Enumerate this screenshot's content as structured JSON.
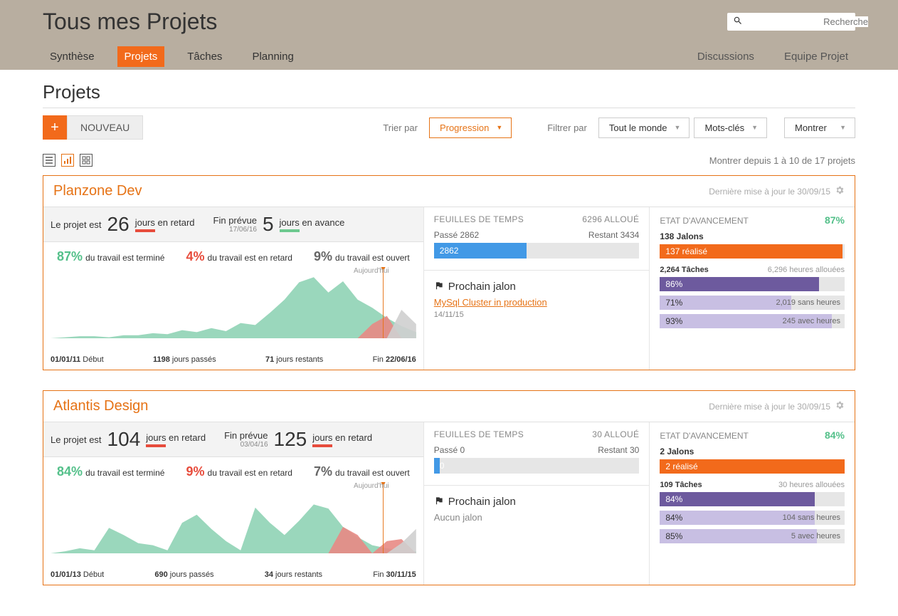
{
  "header": {
    "title": "Tous mes Projets",
    "search_placeholder": "Recherche"
  },
  "nav": {
    "left": [
      "Synthèse",
      "Projets",
      "Tâches",
      "Planning"
    ],
    "right": [
      "Discussions",
      "Equipe Projet"
    ],
    "active_index": 1
  },
  "section": {
    "title": "Projets",
    "new_label": "NOUVEAU",
    "sort_label": "Trier par",
    "sort_value": "Progression",
    "filter_label": "Filtrer par",
    "filter_who": "Tout le monde",
    "filter_tags": "Mots-clés",
    "show_label": "Montrer",
    "pager": "Montrer depuis 1 à 10 de 17 projets"
  },
  "labels": {
    "project_is": "Le projet est",
    "days_late": "jours en retard",
    "days_early": "jours en avance",
    "planned_end": "Fin prévue",
    "today": "Aujourd'hui",
    "start": "Début",
    "end": "Fin",
    "days_passed": "jours passés",
    "days_remaining": "jours restants",
    "timesheets": "FEUILLES DE TEMPS",
    "allocated": "alloué",
    "spent": "Passé",
    "remaining": "Restant",
    "next_milestone": "Prochain jalon",
    "no_milestone": "Aucun jalon",
    "progress": "ETAT D'AVANCEMENT",
    "milestones": "Jalons",
    "done": "réalisé",
    "tasks": "Tâches",
    "hours_allocated": "heures allouées",
    "without_hours": "sans heures",
    "with_hours": "avec heures",
    "work_done": "du travail est terminé",
    "work_late": "du travail est en retard",
    "work_open": "du travail est ouvert",
    "last_update": "Dernière mise à jour le"
  },
  "projects": [
    {
      "name": "Planzone Dev",
      "updated": "30/09/15",
      "delay_days": 26,
      "delay_direction": "late",
      "end_planned_date": "17/06/16",
      "end_delta_days": 5,
      "end_delta_direction": "early",
      "pct_done": 87,
      "pct_late": 4,
      "pct_open": 9,
      "timeline": {
        "start": "01/01/11",
        "end": "22/06/16",
        "days_passed": 1198,
        "days_remaining": 71
      },
      "timesheets": {
        "allocated": 6296,
        "spent": 2862,
        "remaining": 3434,
        "bar_pct": 45
      },
      "milestone": {
        "name": "MySql Cluster in production",
        "date": "14/11/15"
      },
      "progress": {
        "overall_pct": 87,
        "milestones_total": 138,
        "milestones_done": 137,
        "milestones_pct": 99,
        "tasks_total": "2,264",
        "tasks_pct": 86,
        "hours_allocated": "6,296",
        "no_hours_pct": 71,
        "no_hours_count": "2,019",
        "with_hours_pct": 93,
        "with_hours_count": "245"
      },
      "chart_data": {
        "type": "area",
        "series": [
          {
            "name": "done",
            "color": "#8fd3b5",
            "values": [
              0,
              1,
              2,
              2,
              1,
              3,
              3,
              5,
              4,
              8,
              6,
              10,
              7,
              15,
              13,
              25,
              38,
              55,
              60,
              45,
              56,
              38,
              30,
              20,
              12,
              6
            ]
          },
          {
            "name": "late",
            "color": "#e88a84",
            "values": [
              0,
              0,
              0,
              0,
              0,
              0,
              0,
              0,
              0,
              0,
              0,
              0,
              0,
              0,
              0,
              0,
              0,
              0,
              0,
              0,
              0,
              0,
              14,
              22,
              0,
              0
            ]
          },
          {
            "name": "open",
            "color": "#cfcfcf",
            "values": [
              0,
              0,
              0,
              0,
              0,
              0,
              0,
              0,
              0,
              0,
              0,
              0,
              0,
              0,
              0,
              0,
              0,
              0,
              0,
              0,
              0,
              0,
              0,
              0,
              28,
              14
            ]
          }
        ]
      }
    },
    {
      "name": "Atlantis Design",
      "updated": "30/09/15",
      "delay_days": 104,
      "delay_direction": "late",
      "end_planned_date": "03/04/16",
      "end_delta_days": 125,
      "end_delta_direction": "late",
      "pct_done": 84,
      "pct_late": 9,
      "pct_open": 7,
      "timeline": {
        "start": "01/01/13",
        "end": "30/11/15",
        "days_passed": 690,
        "days_remaining": 34
      },
      "timesheets": {
        "allocated": 30,
        "spent": 0,
        "remaining": 30,
        "bar_pct": 0
      },
      "milestone": null,
      "progress": {
        "overall_pct": 84,
        "milestones_total": 2,
        "milestones_done": 2,
        "milestones_pct": 100,
        "tasks_total": "109",
        "tasks_pct": 84,
        "hours_allocated": "30",
        "no_hours_pct": 84,
        "no_hours_count": "104",
        "with_hours_pct": 85,
        "with_hours_count": "5"
      },
      "chart_data": {
        "type": "area",
        "series": [
          {
            "name": "done",
            "color": "#8fd3b5",
            "values": [
              0,
              2,
              5,
              3,
              25,
              18,
              10,
              8,
              3,
              30,
              38,
              24,
              12,
              3,
              45,
              30,
              18,
              32,
              48,
              44,
              26,
              16,
              8,
              5,
              3,
              2
            ]
          },
          {
            "name": "late",
            "color": "#e88a84",
            "values": [
              0,
              0,
              0,
              0,
              0,
              0,
              0,
              0,
              0,
              0,
              0,
              0,
              0,
              0,
              0,
              0,
              0,
              0,
              0,
              0,
              26,
              18,
              0,
              12,
              14,
              0
            ]
          },
          {
            "name": "open",
            "color": "#cfcfcf",
            "values": [
              0,
              0,
              0,
              0,
              0,
              0,
              0,
              0,
              0,
              0,
              0,
              0,
              0,
              0,
              0,
              0,
              0,
              0,
              0,
              0,
              0,
              0,
              0,
              0,
              10,
              24
            ]
          }
        ]
      }
    }
  ]
}
